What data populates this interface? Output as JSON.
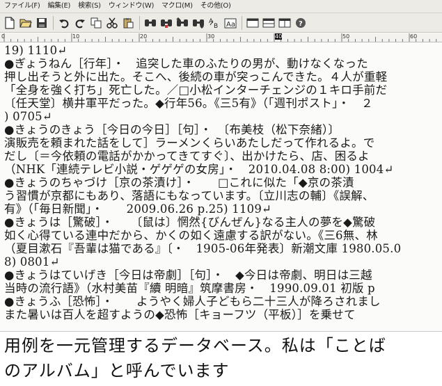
{
  "menu": [
    {
      "label": "ファイル(F)"
    },
    {
      "label": "編集(E)"
    },
    {
      "label": "検索(S)"
    },
    {
      "label": "ウィンドウ(W)"
    },
    {
      "label": "マクロ(M)"
    },
    {
      "label": "その他(O)"
    }
  ],
  "ruler": {
    "labels": [
      "0",
      "10",
      "20",
      "30",
      "40",
      "50",
      "60"
    ]
  },
  "editor": {
    "lines": [
      "19) 1110↵",
      "●ぎょうねん［行年］・　追突した車のふたりの男が、動けなくなった",
      "押し出そうと外に出た。そこへ、後続の車が突っこんできた。４人が重軽",
      "「全身を強く打ち」死亡した。／□小松インターチェンジの１キロ手前だ",
      "〔任天堂〕横井軍平だった。◆行年56。《三5有》（「週刊ポスト」・　２",
      ") 0705↵",
      "●きょうのきょう［今日の今日］［句］・　〔布美枝（松下奈緒）〕",
      "演販売を頼まれた話をして］ラーメンくらいあたしだって作れるよ。で",
      "だし〔＝今依頼の電話がかかってきてすぐ〕、出かけたら、店、困るよ",
      "（NHK「連続テレビ小説・ゲゲゲの女房」・　2010.04.08 8:00) 1004↵",
      "●きょうのちゃづけ［京の茶漬け］・　　□これに似た「◆京の茶漬",
      "う習慣が京都にもあり、落語にもなっています。〔立川志の輔〕《誤解、",
      "有》（「毎日新聞」・　　2009.06.26 p.25) 1109↵",
      "●きょうは［驚破］・　　〔鼠は〕惘然{びんぜん}なる主人の夢を◆驚破",
      "如く心得ている連中だから、かくの如く遠慮する訳がない。《三6無、林",
      "（夏目漱石『吾輩は猫である』〔・　1905-06年発表〕新潮文庫 1980.05.0",
      "8) 0801↵",
      "●きょうはていげき［今日は帝劇］［句］・　◆今日は帝劇、明日は三越",
      "当時の流行語》（水村美苗『續 明暗』筑摩書房・　1990.09.01 初版 p",
      "●きょうふ［恐怖］・　　ようやく婦人子どもら二十三人が降ろされまし",
      "また暑いは百人を超すようの◆恐怖［キョーフツ（平板）］を乗せて　"
    ]
  },
  "caption": {
    "line1": "用例を一元管理するデータベース。私は「ことば",
    "line2": "のアルバム」と呼んでいます"
  },
  "icons": [
    "new-file-icon",
    "open-folder-icon",
    "save-icon",
    "undo-icon",
    "redo-icon",
    "copy-icon",
    "cut-icon",
    "paste-icon",
    "search-icon",
    "search-replace-icon",
    "search-prev-icon",
    "search-next-icon",
    "char-code-icon",
    "format-icon",
    "window-single-icon",
    "window-split-icon",
    "window-tile-icon",
    "help-icon"
  ]
}
